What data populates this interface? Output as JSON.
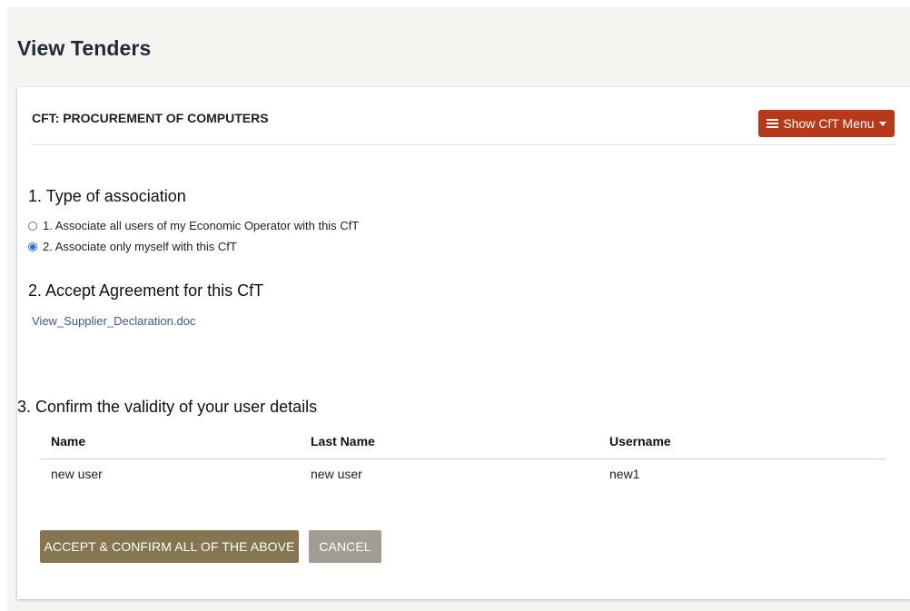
{
  "header": {
    "title": "View Tenders"
  },
  "card": {
    "title": "CFT: PROCUREMENT OF COMPUTERS",
    "menu_button_label": "Show CfT Menu"
  },
  "section1": {
    "heading": "1. Type of association",
    "options": [
      {
        "label": "1. Associate all users of my Economic Operator with this CfT",
        "checked": false
      },
      {
        "label": "2. Associate only myself with this CfT",
        "checked": true
      }
    ]
  },
  "section2": {
    "heading": "2. Accept Agreement for this CfT",
    "link": "View_Supplier_Declaration.doc"
  },
  "section3": {
    "heading": "3. Confirm the validity of your user details",
    "columns": [
      "Name",
      "Last Name",
      "Username"
    ],
    "rows": [
      {
        "name": "new user",
        "last_name": "new user",
        "username": "new1"
      }
    ]
  },
  "actions": {
    "accept_label": "ACCEPT & CONFIRM ALL OF THE ABOVE",
    "cancel_label": "CANCEL"
  },
  "colors": {
    "menu_button": "#b8391a",
    "accept_button": "#857651",
    "cancel_button": "#a19d94",
    "link": "#3a5a8c"
  }
}
